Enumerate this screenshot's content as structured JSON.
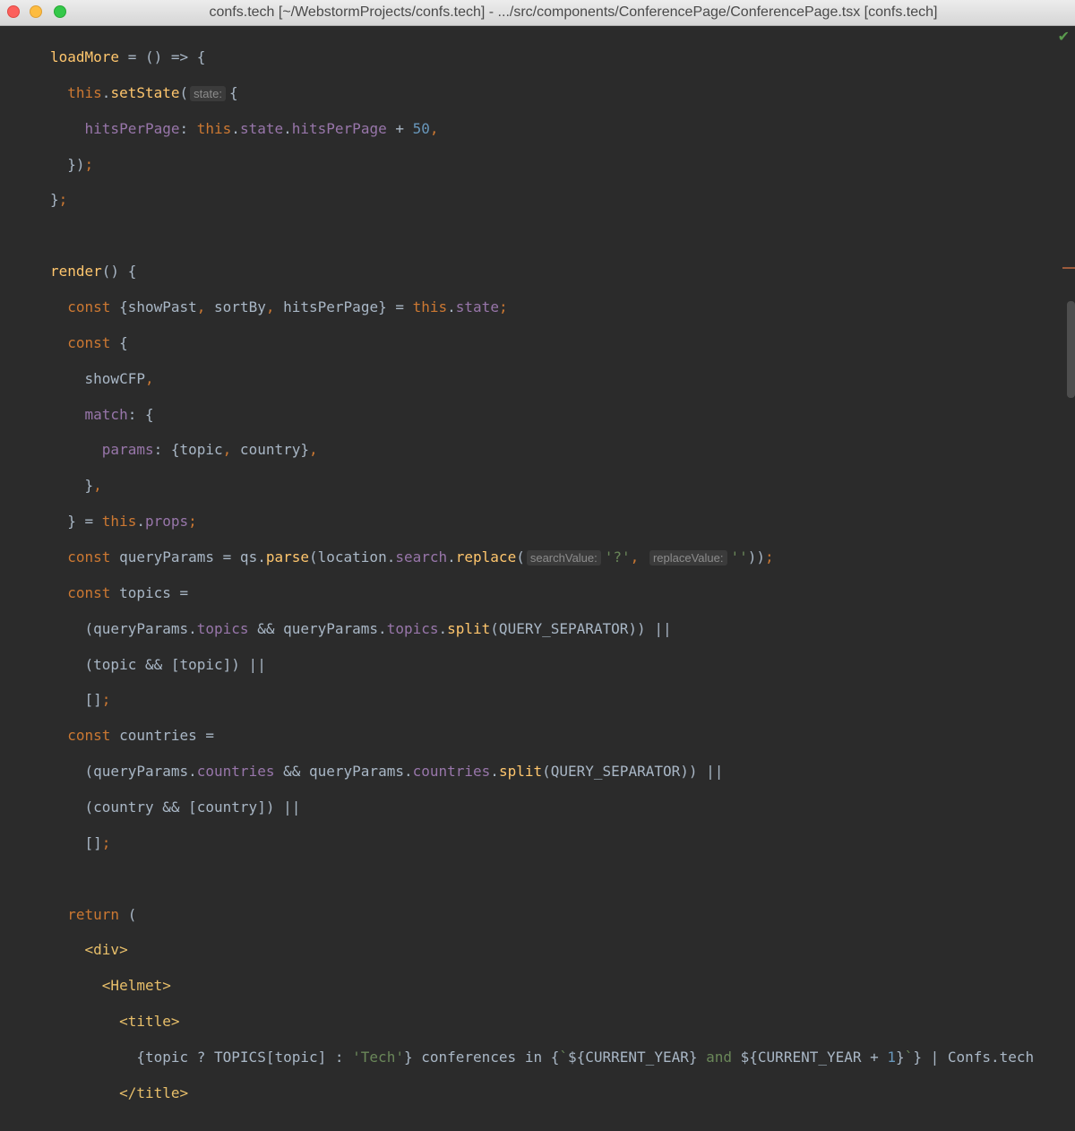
{
  "window": {
    "title": "confs.tech [~/WebstormProjects/confs.tech] - .../src/components/ConferencePage/ConferencePage.tsx [confs.tech]"
  },
  "editor": {
    "status_icon": "checkmark-icon",
    "hints": {
      "state": "state:",
      "search_value": "searchValue:",
      "replace_value": "replaceValue:"
    }
  }
}
